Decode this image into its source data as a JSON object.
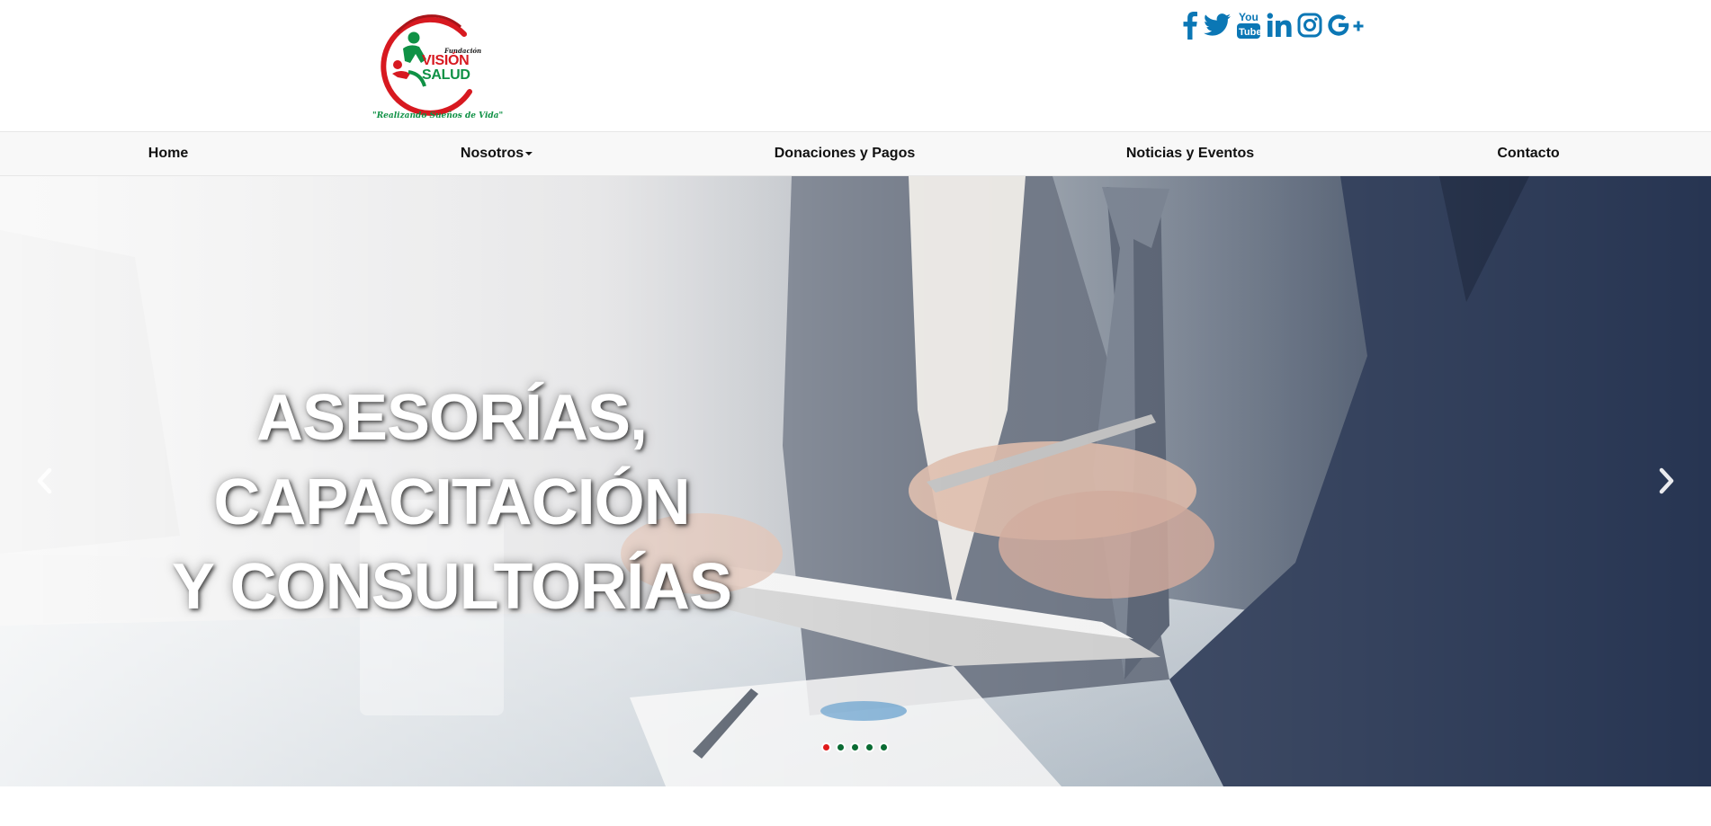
{
  "header": {
    "logo": {
      "kicker": "Fundación",
      "name_top": "VISIÓN",
      "name_bottom": "SALUD",
      "tagline": "\"Realizando Sueños de Vida\""
    },
    "social": [
      {
        "icon": "facebook-icon",
        "label": "Facebook"
      },
      {
        "icon": "twitter-icon",
        "label": "Twitter"
      },
      {
        "icon": "youtube-icon",
        "label": "YouTube"
      },
      {
        "icon": "linkedin-icon",
        "label": "LinkedIn"
      },
      {
        "icon": "instagram-icon",
        "label": "Instagram"
      },
      {
        "icon": "google-plus-icon",
        "label": "Google+"
      }
    ],
    "social_color": "#0b77b5"
  },
  "nav": {
    "items": [
      {
        "label": "Home"
      },
      {
        "label": "Nosotros",
        "has_dropdown": true
      },
      {
        "label": "Donaciones y Pagos"
      },
      {
        "label": "Noticias y Eventos"
      },
      {
        "label": "Contacto"
      }
    ]
  },
  "carousel": {
    "heading_line1": "ASESORÍAS, CAPACITACIÓN",
    "heading_line2": "Y CONSULTORÍAS",
    "prev_icon": "chevron-left-icon",
    "next_icon": "chevron-right-icon",
    "slide_count": 5,
    "active_slide": 1,
    "indicator_active_color": "#e01b1b",
    "indicator_color": "#0a6b33"
  }
}
